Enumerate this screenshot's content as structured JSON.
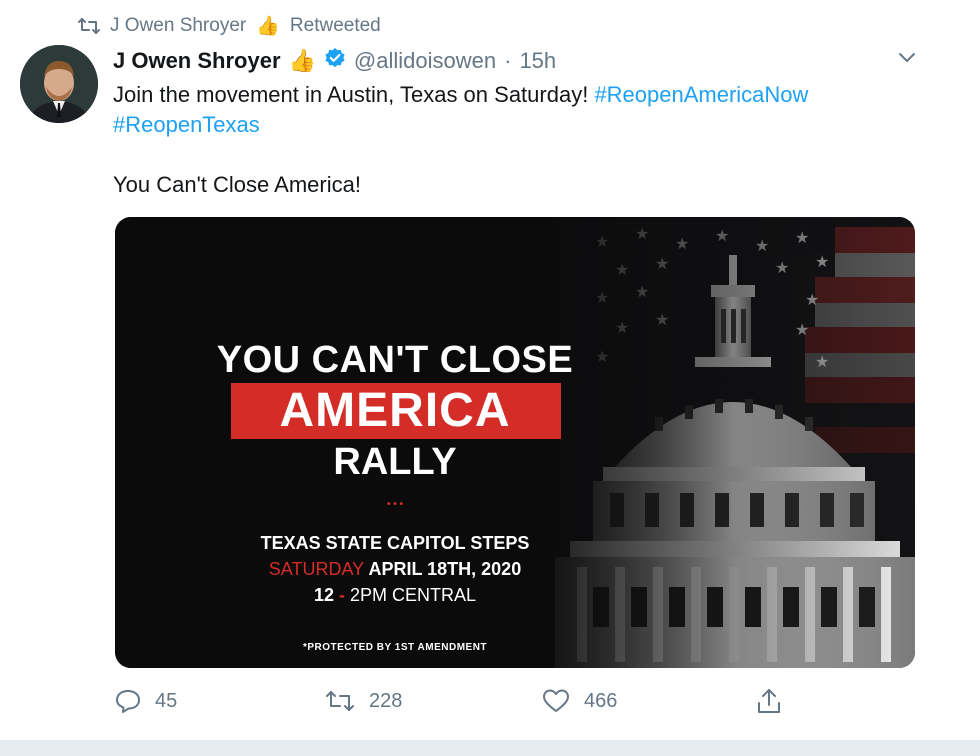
{
  "retweet": {
    "label": "J Owen Shroyer",
    "emoji": "👍",
    "status": "Retweeted"
  },
  "tweet": {
    "author_name": "J Owen Shroyer",
    "author_emoji": "👍",
    "handle": "@allidoisowen",
    "separator": "·",
    "time": "15h",
    "text_line1": "Join the movement in Austin, Texas on Saturday!",
    "hashtag1": "#ReopenAmericaNow",
    "hashtag2": "#ReopenTexas",
    "text_line2": "You Can't Close America!"
  },
  "poster": {
    "line1": "YOU CAN'T CLOSE",
    "line2": "AMERICA",
    "line3": "RALLY",
    "dots": "• • •",
    "location": "TEXAS STATE CAPITOL STEPS",
    "day": "SATURDAY",
    "date": "APRIL 18TH, 2020",
    "time_start": "12",
    "time_sep": "-",
    "time_end": "2PM CENTRAL",
    "footnote": "*PROTECTED BY 1ST AMENDMENT"
  },
  "actions": {
    "replies": "45",
    "retweets": "228",
    "likes": "466"
  },
  "colors": {
    "accent": "#1da1f2",
    "muted": "#657786",
    "poster_red": "#d42c27"
  },
  "icons": [
    "retweet-icon",
    "verified-badge-icon",
    "chevron-down-icon",
    "reply-icon",
    "like-icon",
    "share-icon",
    "thumbs-up-emoji"
  ]
}
